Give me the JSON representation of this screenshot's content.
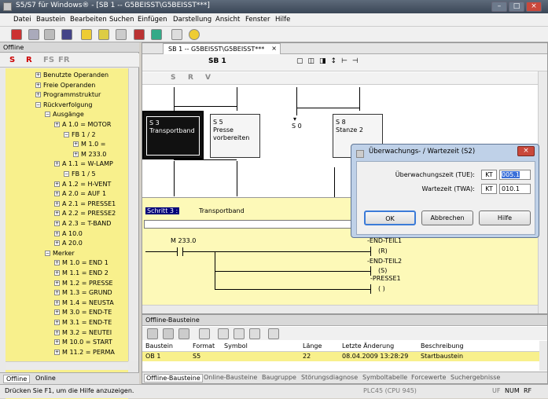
{
  "window": {
    "title": "S5/S7 für Windows® - [SB 1 -- G5BEISST\\G5BEISST***]"
  },
  "menu": [
    "Datei",
    "Baustein",
    "Bearbeiten",
    "Suchen",
    "Einfügen",
    "Darstellung",
    "Ansicht",
    "Fenster",
    "Hilfe"
  ],
  "left_panel": {
    "title": "Offline",
    "toolbar": [
      "S",
      "R",
      "FS",
      "FR"
    ],
    "tree": [
      {
        "label": "Benutzte Operanden",
        "level": 0
      },
      {
        "label": "Freie Operanden",
        "level": 0
      },
      {
        "label": "Programmstruktur",
        "level": 0
      },
      {
        "label": "Rückverfolgung",
        "level": 0
      },
      {
        "label": "Ausgänge",
        "level": 1
      },
      {
        "label": "A 1.0 = MOTOR",
        "level": 2
      },
      {
        "label": "FB 1 / 2",
        "level": 3
      },
      {
        "label": "M 1.0 =",
        "level": 4
      },
      {
        "label": "M 233.0",
        "level": 4
      },
      {
        "label": "A 1.1 = W-LAMP",
        "level": 2
      },
      {
        "label": "FB 1 / 5",
        "level": 3
      },
      {
        "label": "A 1.2 = H-VENT",
        "level": 2
      },
      {
        "label": "A 2.0 = AUF 1",
        "level": 2
      },
      {
        "label": "A 2.1 = PRESSE1",
        "level": 2
      },
      {
        "label": "A 2.2 = PRESSE2",
        "level": 2
      },
      {
        "label": "A 2.3 = T-BAND",
        "level": 2
      },
      {
        "label": "A 10.0",
        "level": 2
      },
      {
        "label": "A 20.0",
        "level": 2
      },
      {
        "label": "Merker",
        "level": 1
      },
      {
        "label": "M 1.0 = END 1",
        "level": 2
      },
      {
        "label": "M 1.1 = END 2",
        "level": 2
      },
      {
        "label": "M 1.2 = PRESSE",
        "level": 2
      },
      {
        "label": "M 1.3 = GRUND",
        "level": 2
      },
      {
        "label": "M 1.4 = NEUSTA",
        "level": 2
      },
      {
        "label": "M 3.0 = END-TE",
        "level": 2
      },
      {
        "label": "M 3.1 = END-TE",
        "level": 2
      },
      {
        "label": "M 3.2 = NEUTEI",
        "level": 2
      },
      {
        "label": "M 10.0 = START",
        "level": 2
      },
      {
        "label": "M 11.2 = PERMA",
        "level": 2
      }
    ],
    "tabs": [
      "Offline",
      "Online"
    ]
  },
  "editor": {
    "tab_label": "SB 1 -- G5BEISST\\G5BEISST***",
    "block_name": "SB 1",
    "edit_tools": [
      "S",
      "R",
      "V"
    ],
    "steps": [
      {
        "num": "S 3",
        "name": "Transportband"
      },
      {
        "num": "S 5",
        "name": "Presse vorbereiten"
      },
      {
        "num": "S 0",
        "name": ""
      },
      {
        "num": "S 8",
        "name": "Stanze 2"
      }
    ],
    "ladder": {
      "step_label": "Schritt 3 :",
      "step_name": "Transportband",
      "contact": "M 233.0",
      "coils": [
        {
          "name": "-END-TEIL1",
          "type": "(R)"
        },
        {
          "name": "-END-TEIL2",
          "type": "(S)"
        },
        {
          "name": "-PRESSE1",
          "type": "( )"
        }
      ]
    }
  },
  "dialog": {
    "title": "Überwachungs- / Wartezeit (S2)",
    "tue_label": "Überwachungszeit (TUE):",
    "twa_label": "Wartezeit (TWA):",
    "kt": "KT",
    "tue_value": "005.1",
    "twa_value": "010.1",
    "ok": "OK",
    "cancel": "Abbrechen",
    "help": "Hilfe"
  },
  "bottom_panel": {
    "title": "Offline-Bausteine",
    "columns": [
      "Baustein",
      "Format",
      "Symbol",
      "Länge",
      "Letzte Änderung",
      "Beschreibung"
    ],
    "rows": [
      [
        "OB 1",
        "S5",
        "",
        "22",
        "08.04.2009 13:28:29",
        "Startbaustein"
      ]
    ],
    "tabs": [
      "Offline-Bausteine",
      "Online-Bausteine",
      "Baugruppe",
      "Störungsdiagnose",
      "Symboltabelle",
      "Forcewerte",
      "Suchergebnisse"
    ]
  },
  "status": {
    "hint": "Drücken Sie F1, um die Hilfe anzuzeigen.",
    "plc": "PLC45 (CPU 945)",
    "caps": "UF",
    "num": "NUM",
    "rf": "RF"
  },
  "colors": {
    "tree_bg": "#f8f08c",
    "ladder_bg": "#fdf9b8",
    "dialog_frame": "#bfd1e8"
  }
}
